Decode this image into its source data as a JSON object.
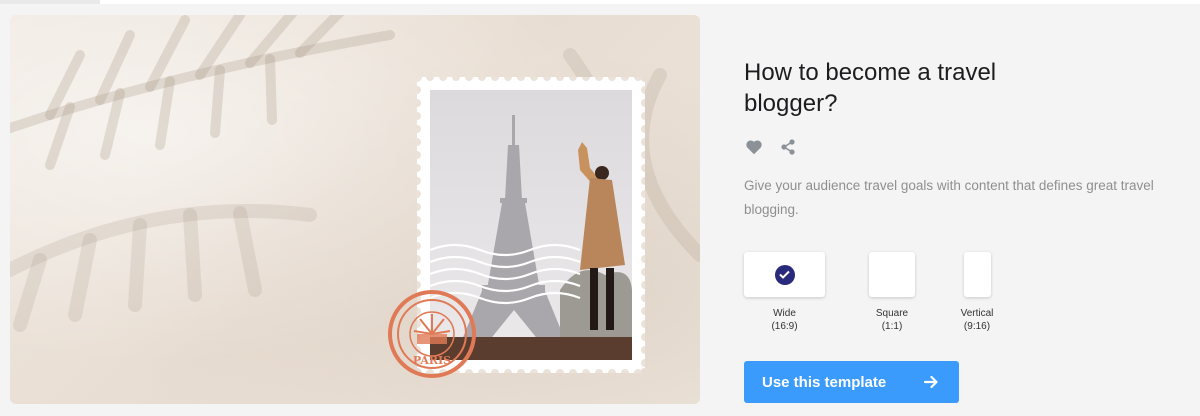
{
  "template": {
    "title": "How to become a travel blogger?",
    "description": "Give your audience travel goals with content that defines great travel blogging."
  },
  "actions": {
    "like_icon": "heart-icon",
    "share_icon": "share-icon"
  },
  "formats": [
    {
      "name": "Wide",
      "ratio": "(16:9)",
      "selected": true
    },
    {
      "name": "Square",
      "ratio": "(1:1)",
      "selected": false
    },
    {
      "name": "Vertical",
      "ratio": "(9:16)",
      "selected": false
    }
  ],
  "cta": {
    "label": "Use this template",
    "icon": "arrow-right-icon"
  },
  "preview": {
    "postmark_text": "PARIS"
  },
  "colors": {
    "accent": "#3a9bfc",
    "selected_check": "#2a2a7d",
    "postmark": "#e07a56"
  }
}
